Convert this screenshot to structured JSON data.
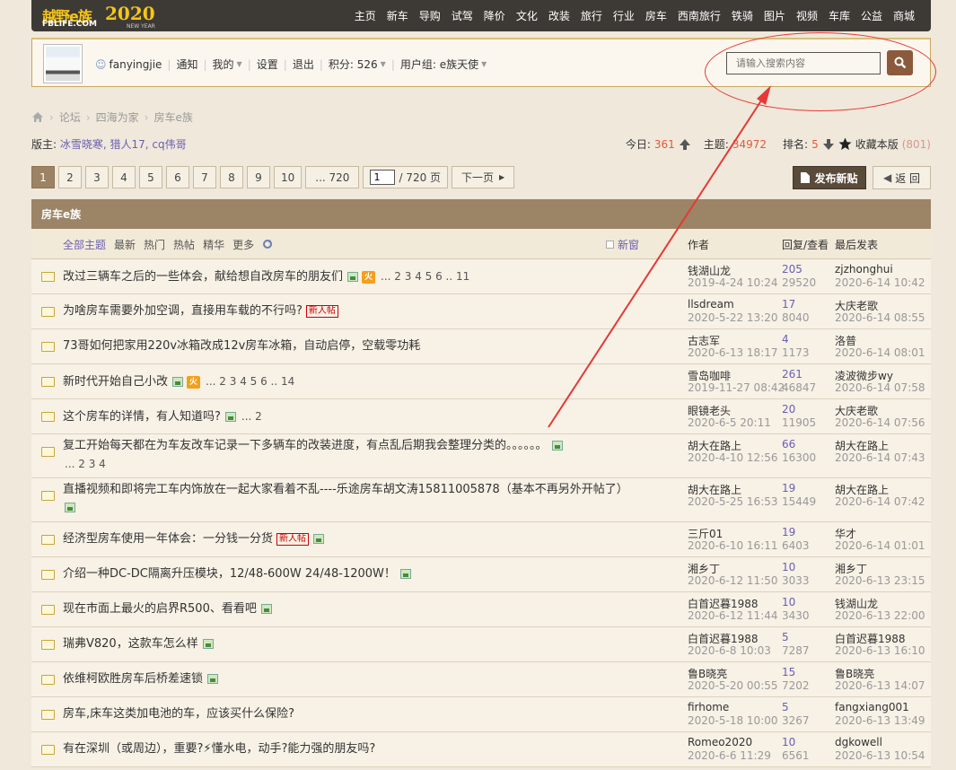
{
  "site": {
    "logo_main": "越野e族",
    "logo_sub": "FBLIFE.COM",
    "logo_year": "2020",
    "logo_year_sub": "NEW YEAR"
  },
  "topnav": [
    "主页",
    "新车",
    "导购",
    "试驾",
    "降价",
    "文化",
    "改装",
    "旅行",
    "行业",
    "房车",
    "西南旅行",
    "铁骑",
    "图片",
    "视频",
    "车库",
    "公益",
    "商城"
  ],
  "user": {
    "name": "fanyingjie",
    "notice": "通知",
    "mine": "我的",
    "settings": "设置",
    "logout": "退出",
    "points_label": "积分:",
    "points": "526",
    "group_label": "用户组:",
    "group": "e族天使"
  },
  "search": {
    "placeholder": "请输入搜索内容"
  },
  "breadcrumb": [
    "论坛",
    "四海为家",
    "房车e族"
  ],
  "moderators": {
    "label": "版主:",
    "names": "冰雪晓寒, 猎人17, cq伟哥"
  },
  "stats": {
    "today_label": "今日:",
    "today": "361",
    "topics_label": "主题:",
    "topics": "34972",
    "rank_label": "排名:",
    "rank": "5",
    "fav_label": "收藏本版",
    "fav_count": "(801)"
  },
  "pager": {
    "pages": [
      "1",
      "2",
      "3",
      "4",
      "5",
      "6",
      "7",
      "8",
      "9",
      "10"
    ],
    "last": "... 720",
    "input": "1",
    "total": "/ 720 页",
    "next": "下一页"
  },
  "buttons": {
    "post": "发布新贴",
    "back": "返 回"
  },
  "forum_title": "房车e族",
  "filters": {
    "all": "全部主题",
    "items": [
      "最新",
      "热门",
      "热帖",
      "精华",
      "更多"
    ],
    "newwin": "新窗",
    "col_author": "作者",
    "col_reply": "回复/查看",
    "col_last": "最后发表"
  },
  "threads": [
    {
      "title": "改过三辆车之后的一些体会，献给想自改房车的朋友们",
      "img": true,
      "hot": "火",
      "pages": "... 2  3  4  5  6 .. 11",
      "author": "钱湖山龙",
      "adate": "2019-4-24 10:24",
      "replies": "205",
      "views": "29520",
      "last": "zjzhonghui",
      "ldate": "2020-6-14 10:42"
    },
    {
      "title": "为啥房车需要外加空调，直接用车载的不行吗?",
      "newtag": "新人帖",
      "author": "llsdream",
      "adate": "2020-5-22 13:20",
      "replies": "17",
      "views": "8040",
      "last": "大庆老歌",
      "ldate": "2020-6-14 08:55"
    },
    {
      "title": "73哥如何把家用220v冰箱改成12v房车冰箱，自动启停，空载零功耗",
      "author": "古志军",
      "adate": "2020-6-13 18:17",
      "replies": "4",
      "views": "1173",
      "last": "洛普",
      "ldate": "2020-6-14 08:01"
    },
    {
      "title": "新时代开始自己小改",
      "img": true,
      "hot": "火",
      "pages": "... 2  3  4  5  6 .. 14",
      "author": "雪岛咖啡",
      "adate": "2019-11-27 08:42",
      "replies": "261",
      "views": "46847",
      "last": "凌波微步wy",
      "ldate": "2020-6-14 07:58"
    },
    {
      "title": "这个房车的详情，有人知道吗?",
      "img": true,
      "pages": "... 2",
      "author": "眼镜老头",
      "adate": "2020-6-5 20:11",
      "replies": "20",
      "views": "11905",
      "last": "大庆老歌",
      "ldate": "2020-6-14 07:56"
    },
    {
      "title": "复工开始每天都在为车友改车记录一下多辆车的改装进度，有点乱后期我会整理分类的。。。。。。",
      "img": true,
      "pages2": "... 2  3  4",
      "author": "胡大在路上",
      "adate": "2020-4-10 12:56",
      "replies": "66",
      "views": "16300",
      "last": "胡大在路上",
      "ldate": "2020-6-14 07:43"
    },
    {
      "title": "直播视频和即将完工车内饰放在一起大家看着不乱----乐途房车胡文涛15811005878（基本不再另外开帖了）",
      "img2": true,
      "author": "胡大在路上",
      "adate": "2020-5-25 16:53",
      "replies": "19",
      "views": "15449",
      "last": "胡大在路上",
      "ldate": "2020-6-14 07:42"
    },
    {
      "title": "经济型房车使用一年体会：一分钱一分货",
      "newtag": "新人帖",
      "img": true,
      "author": "三斤01",
      "adate": "2020-6-10 16:11",
      "replies": "19",
      "views": "6403",
      "last": "华才",
      "ldate": "2020-6-14 01:01"
    },
    {
      "title": "介绍一种DC-DC隔离升压模块，12/48-600W 24/48-1200W！",
      "img": true,
      "author": "湘乡丁",
      "adate": "2020-6-12 11:50",
      "replies": "10",
      "views": "3033",
      "last": "湘乡丁",
      "ldate": "2020-6-13 23:15"
    },
    {
      "title": "现在市面上最火的启界R500、看看吧",
      "img": true,
      "author": "白首迟暮1988",
      "adate": "2020-6-12 11:44",
      "replies": "10",
      "views": "3430",
      "last": "钱湖山龙",
      "ldate": "2020-6-13 22:00"
    },
    {
      "title": "瑞弗V820，这款车怎么样",
      "img": true,
      "author": "白首迟暮1988",
      "adate": "2020-6-8 10:03",
      "replies": "5",
      "views": "7287",
      "last": "白首迟暮1988",
      "ldate": "2020-6-13 16:10"
    },
    {
      "title": "依维柯欧胜房车后桥差速锁",
      "img": true,
      "author": "鲁B晓亮",
      "adate": "2020-5-20 00:55",
      "replies": "15",
      "views": "7202",
      "last": "鲁B晓亮",
      "ldate": "2020-6-13 14:07"
    },
    {
      "title": "房车,床车这类加电池的车，应该买什么保险?",
      "author": "firhome",
      "adate": "2020-5-18 10:00",
      "replies": "5",
      "views": "3267",
      "last": "fangxiang001",
      "ldate": "2020-6-13 13:49"
    },
    {
      "title": "有在深圳（或周边），重要?⚡懂水电，动手?能力强的朋友吗?",
      "author": "Romeo2020",
      "adate": "2020-6-6 11:29",
      "replies": "10",
      "views": "6561",
      "last": "dgkowell",
      "ldate": "2020-6-13 10:54"
    }
  ]
}
